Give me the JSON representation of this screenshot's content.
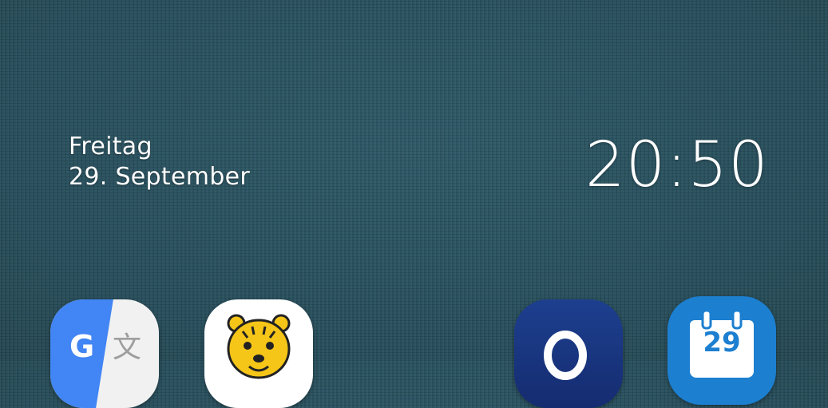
{
  "clock": {
    "day": "Freitag",
    "date": "29. September",
    "time": "20:50"
  },
  "apps": [
    {
      "name": "Google Translate",
      "icon": "google-translate-icon"
    },
    {
      "name": "Tiger app",
      "icon": "tiger-icon"
    },
    {
      "name": "o2",
      "icon": "o2-icon"
    },
    {
      "name": "Kalender",
      "icon": "calendar-icon",
      "badge_text": "29"
    }
  ],
  "colors": {
    "wallpaper": "#27505e",
    "text": "#ffffff",
    "translate_blue": "#4285f4",
    "o2_blue": "#1d3f8f",
    "calendar_blue": "#1c7fd0",
    "tiger_yellow": "#f5c518"
  }
}
